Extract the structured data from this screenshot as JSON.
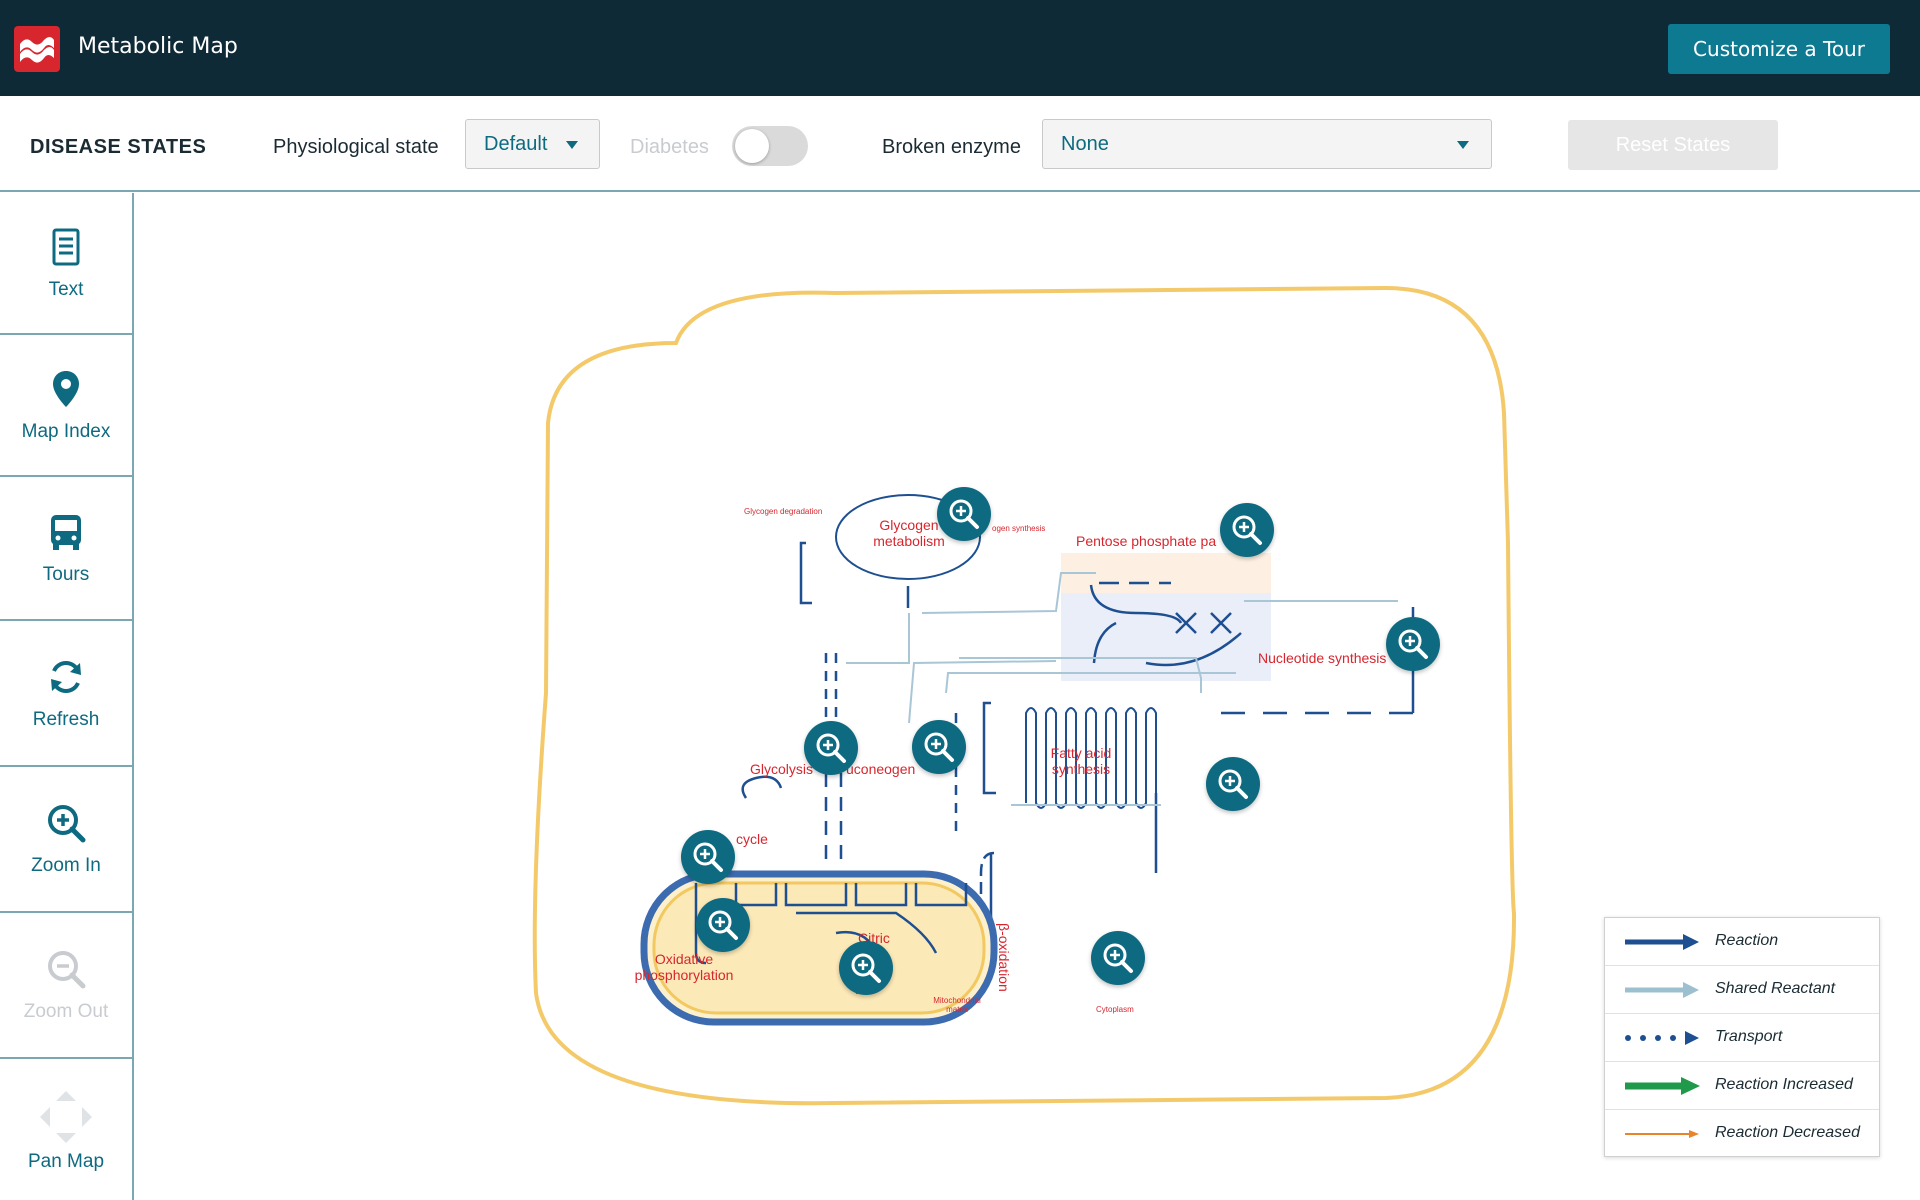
{
  "header": {
    "title": "Metabolic Map",
    "tour_button": "Customize a Tour"
  },
  "controls": {
    "section_title": "DISEASE STATES",
    "physiological_label": "Physiological state",
    "physiological_value": "Default",
    "diabetes_label": "Diabetes",
    "diabetes_on": false,
    "broken_enzyme_label": "Broken enzyme",
    "broken_enzyme_value": "None",
    "reset_button": "Reset States"
  },
  "sidebar": {
    "items": [
      {
        "label": "Text",
        "icon": "document-icon"
      },
      {
        "label": "Map Index",
        "icon": "map-pin-icon"
      },
      {
        "label": "Tours",
        "icon": "bus-icon"
      },
      {
        "label": "Refresh",
        "icon": "refresh-icon"
      },
      {
        "label": "Zoom In",
        "icon": "zoom-in-icon"
      },
      {
        "label": "Zoom Out",
        "icon": "zoom-out-icon",
        "disabled": true
      },
      {
        "label": "Pan Map",
        "icon": "pan-icon"
      }
    ]
  },
  "map": {
    "labels": {
      "glycogen_degradation": "Glycogen degradation",
      "glycogen_metabolism": "Glycogen metabolism",
      "glycogen_synthesis": "ogen synthesis",
      "pentose_phosphate": "Pentose phosphate pa",
      "nucleotide_synthesis": "Nucleotide synthesis",
      "fatty_acid_synthesis": "Fatty acid synthesis",
      "glycolysis": "Glycolysis",
      "gluconeogenesis": "uconeogen",
      "urea_cycle": "cycle",
      "oxidative_phosphorylation": "Oxidative phosphorylation",
      "citric": "Citric",
      "beta_oxidation": "β-oxidation",
      "mitochondrial_matrix": "Mitochondrial matrix",
      "cytoplasm": "Cytoplasm"
    }
  },
  "legend": {
    "items": [
      {
        "label": "Reaction",
        "color": "#1d4f91"
      },
      {
        "label": "Shared Reactant",
        "color": "#9cc0d0"
      },
      {
        "label": "Transport",
        "color": "#1d4f91"
      },
      {
        "label": "Reaction Increased",
        "color": "#1e9a4a"
      },
      {
        "label": "Reaction Decreased",
        "color": "#e8842a"
      }
    ]
  },
  "colors": {
    "header_bg": "#0f2a37",
    "accent": "#0e7a92",
    "pathway_label": "#d7262e",
    "cell_outline": "#f4c96a"
  }
}
